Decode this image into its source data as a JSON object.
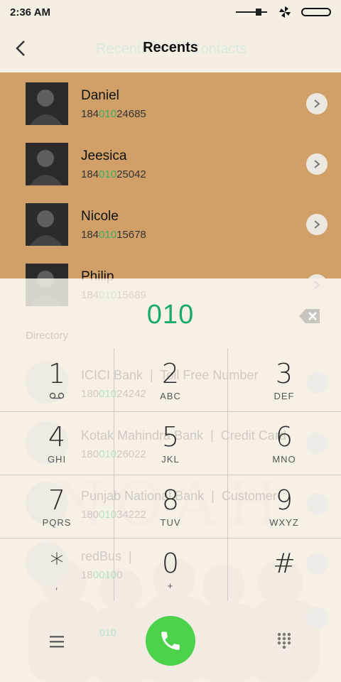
{
  "status": {
    "time": "2:36 AM"
  },
  "header": {
    "tab_recents_faded": "Recents",
    "tab_contacts_faded": "Contacts",
    "title": "Recents"
  },
  "contacts": [
    {
      "name": "Daniel",
      "number_pre": "184",
      "number_match": "010",
      "number_post": "24685"
    },
    {
      "name": "Jeesica",
      "number_pre": "184",
      "number_match": "010",
      "number_post": "25042"
    },
    {
      "name": "Nicole",
      "number_pre": "184",
      "number_match": "010",
      "number_post": "15678"
    },
    {
      "name": "Philip",
      "number_pre": "184",
      "number_match": "010",
      "number_post": "15689"
    }
  ],
  "dialer": {
    "input": "010",
    "directory_header": "Directory",
    "directory": [
      {
        "name": "ICICI Bank",
        "tag": "Toll Free Number",
        "number_pre": "180",
        "number_match": "010",
        "number_post": "24242"
      },
      {
        "name": "Kotak Mahindra Bank",
        "tag": "Credit Card",
        "number_pre": "180",
        "number_match": "010",
        "number_post": "26022"
      },
      {
        "name": "Punjab National Bank",
        "tag": "Customer",
        "number_pre": "180",
        "number_match": "010",
        "number_post": "34222"
      },
      {
        "name": "redBus",
        "tag": "",
        "number_pre": "18",
        "number_match": "0010",
        "number_post": "0"
      }
    ],
    "keys": [
      {
        "digit": "1",
        "letters": ""
      },
      {
        "digit": "2",
        "letters": "ABC"
      },
      {
        "digit": "3",
        "letters": "DEF"
      },
      {
        "digit": "4",
        "letters": "GHI"
      },
      {
        "digit": "5",
        "letters": "JKL"
      },
      {
        "digit": "6",
        "letters": "MNO"
      },
      {
        "digit": "7",
        "letters": "PQRS"
      },
      {
        "digit": "8",
        "letters": "TUV"
      },
      {
        "digit": "9",
        "letters": "WXYZ"
      },
      {
        "digit": "*",
        "letters": ","
      },
      {
        "digit": "0",
        "letters": "+"
      },
      {
        "digit": "#",
        "letters": ""
      }
    ],
    "bottom_faded_number": "010"
  },
  "colors": {
    "accent": "#1aaa6a",
    "highlight_row": "#d0a068",
    "call": "#4cd14a"
  },
  "icons": {
    "back": "back-arrow-icon",
    "chevron": "chevron-right-icon",
    "backspace": "backspace-icon",
    "voicemail": "voicemail-icon",
    "menu": "menu-icon",
    "call": "phone-icon",
    "keypad": "dialpad-icon"
  }
}
